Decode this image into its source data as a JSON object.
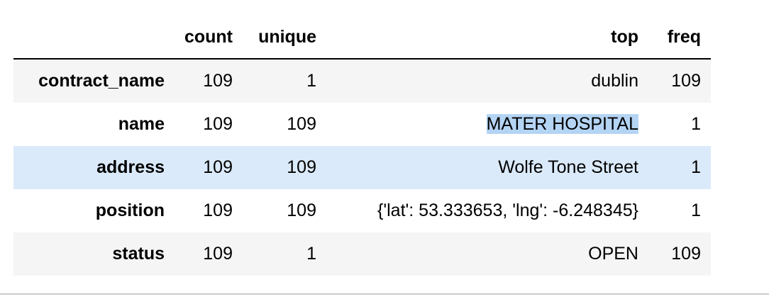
{
  "table": {
    "columns": [
      "",
      "count",
      "unique",
      "top",
      "freq"
    ],
    "rows": [
      {
        "index": "contract_name",
        "count": "109",
        "unique": "1",
        "top": "dublin",
        "freq": "109"
      },
      {
        "index": "name",
        "count": "109",
        "unique": "109",
        "top": "MATER HOSPITAL",
        "freq": "1"
      },
      {
        "index": "address",
        "count": "109",
        "unique": "109",
        "top": "Wolfe Tone Street",
        "freq": "1"
      },
      {
        "index": "position",
        "count": "109",
        "unique": "109",
        "top": "{'lat': 53.333653, 'lng': -6.248345}",
        "freq": "1"
      },
      {
        "index": "status",
        "count": "109",
        "unique": "1",
        "top": "OPEN",
        "freq": "109"
      }
    ]
  },
  "selection": {
    "row": 1,
    "column": "top",
    "highlight_color": "#b4d4f4"
  },
  "hover_row": 2,
  "colors": {
    "odd_row": "#f5f5f5",
    "hover_row": "#dbeafa",
    "header_rule": "#000000",
    "cell_separator": "#c9c9c9"
  }
}
